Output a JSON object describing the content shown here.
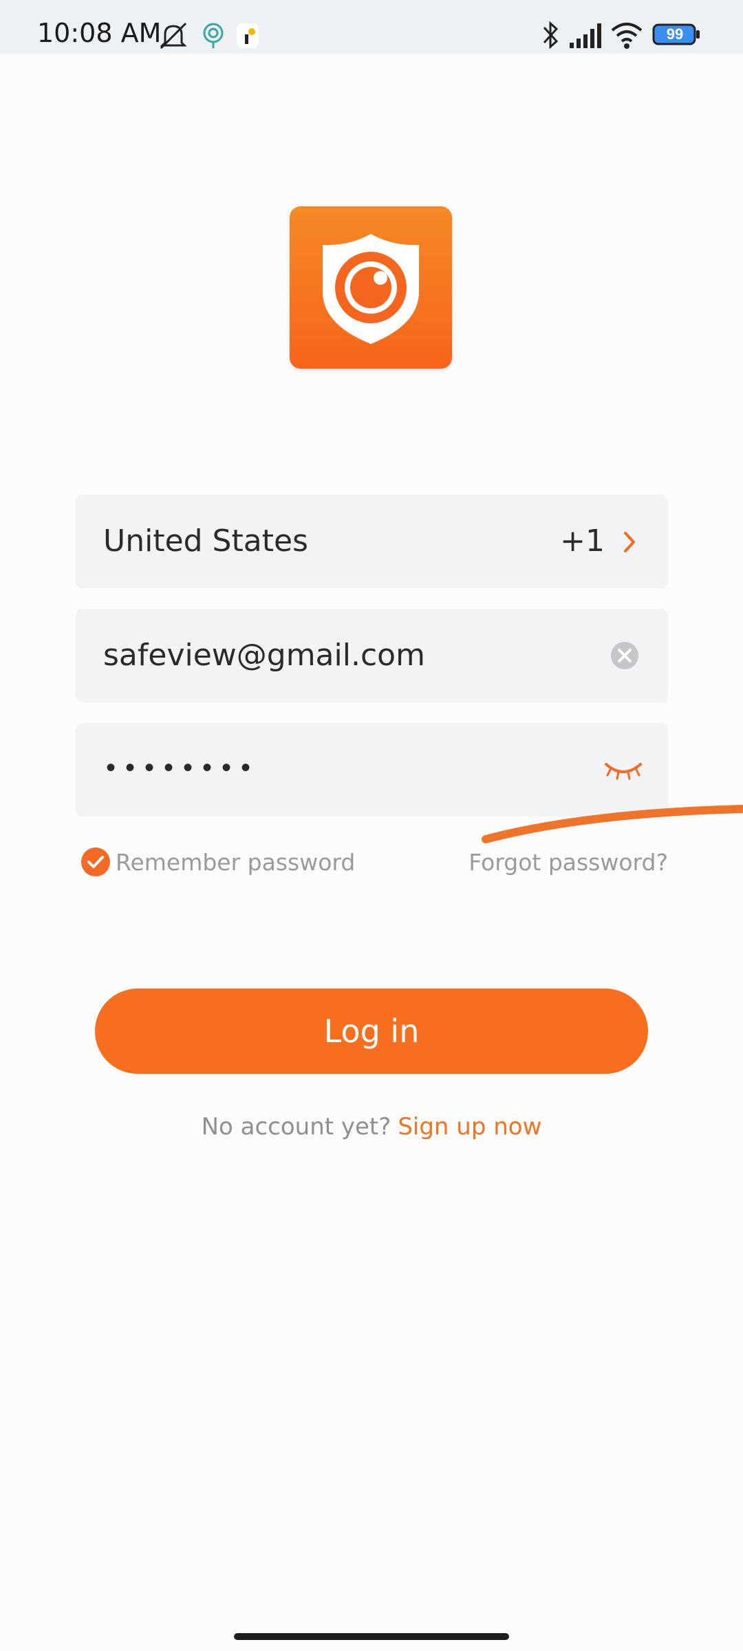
{
  "status_bar": {
    "time": "10:08 AM",
    "battery": "99",
    "icons": [
      "mute-bell-icon",
      "hotspot-icon",
      "notification-icon",
      "bluetooth-icon",
      "signal-icon",
      "wifi-icon",
      "battery-icon"
    ]
  },
  "login": {
    "country": {
      "name": "United States",
      "code": "+1"
    },
    "email_value": "safeview@gmail.com",
    "password_mask": "••••••••",
    "remember_label": "Remember password",
    "remember_checked": true,
    "forgot_label": "Forgot password?",
    "login_button": "Log in",
    "signup_prompt": "No account yet?",
    "signup_link": "Sign up now"
  },
  "colors": {
    "accent": "#f76f1e",
    "field_bg": "#f2f3f5",
    "muted_text": "#9a9a9a"
  }
}
